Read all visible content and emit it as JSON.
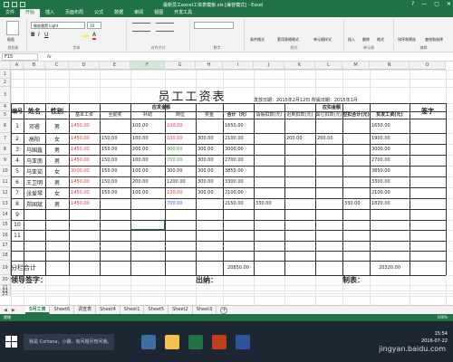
{
  "window": {
    "title": "最新员工excel工资表模板.xls [兼容模式] - Excel",
    "controls": [
      "?",
      "—",
      "▢",
      "✕"
    ]
  },
  "ribbon_tabs": [
    "文件",
    "开始",
    "插入",
    "页面布局",
    "公式",
    "数据",
    "审阅",
    "视图",
    "开发工具"
  ],
  "ribbon": {
    "font_name": "微软雅黑 Light",
    "font_size": "10",
    "groups": [
      "剪贴板",
      "字体",
      "对齐方式",
      "数字",
      "样式",
      "单元格",
      "编辑"
    ],
    "labels": {
      "paste": "粘贴",
      "number_format": "常规",
      "cond_format": "条件格式",
      "table_format": "套用表格格式",
      "cell_style": "单元格样式",
      "insert": "插入",
      "delete": "删除",
      "format": "格式",
      "sort_filter": "排序和筛选",
      "find_select": "查找和选择"
    }
  },
  "formula_bar": {
    "name_box": "F15",
    "fx": "fx",
    "value": ""
  },
  "columns": [
    "A",
    "B",
    "C",
    "D",
    "E",
    "F",
    "G",
    "H",
    "I",
    "J",
    "K",
    "L",
    "M",
    "N",
    "O"
  ],
  "rows": [
    "1",
    "2",
    "3",
    "4",
    "5",
    "6",
    "7",
    "8",
    "9",
    "10",
    "11",
    "12",
    "13",
    "14",
    "15",
    "16",
    "17",
    "18",
    "19",
    "20",
    "21",
    "22",
    "23"
  ],
  "sheet": {
    "title": "员工工资表",
    "issue_date": "发放日期：2015年2月12日 所属日期：2015年1月",
    "group_due": "应发金额",
    "group_deduct": "应扣金额",
    "headers": {
      "no": "编号",
      "name": "姓名",
      "gender": "性别",
      "base": "基本工资",
      "attendance": "全勤奖",
      "subsidy": "补助",
      "post": "岗位",
      "bonus": "奖金",
      "total": "合计（元）",
      "leave": "请假扣款(元)",
      "late": "迟到扣款(元)",
      "other": "其它扣款(元)",
      "deduct_total": "应扣合计(元)",
      "net": "实发工资(元)",
      "sign": "签字"
    },
    "employees": [
      {
        "no": "1",
        "name": "邓睿",
        "gender": "男",
        "base": "1450.00",
        "attendance": "",
        "subsidy": "100.00",
        "post": "100.00",
        "bonus": "",
        "total": "1650.00",
        "leave": "",
        "late": "",
        "other": "",
        "deduct_total": "",
        "net": "1650.00"
      },
      {
        "no": "2",
        "name": "高阳",
        "gender": "女",
        "base": "1450.00",
        "attendance": "150.00",
        "subsidy": "100.00",
        "post": "100.00",
        "bonus": "300.00",
        "total": "2100.00",
        "leave": "",
        "late": "200.00",
        "other": "200.00",
        "deduct_total": "",
        "net": "1900.00"
      },
      {
        "no": "3",
        "name": "马国鑫",
        "gender": "男",
        "base": "1450.00",
        "attendance": "150.00",
        "subsidy": "200.00",
        "post": "900.00",
        "bonus": "300.00",
        "total": "3000.00",
        "leave": "",
        "late": "",
        "other": "",
        "deduct_total": "",
        "net": "3000.00"
      },
      {
        "no": "4",
        "name": "马亚南",
        "gender": "男",
        "base": "1450.00",
        "attendance": "150.00",
        "subsidy": "100.00",
        "post": "700.00",
        "bonus": "300.00",
        "total": "2700.00",
        "leave": "",
        "late": "",
        "other": "",
        "deduct_total": "",
        "net": "2700.00"
      },
      {
        "no": "5",
        "name": "马亚茹",
        "gender": "女",
        "base": "3000.00",
        "attendance": "150.00",
        "subsidy": "100.00",
        "post": "300.00",
        "bonus": "300.00",
        "total": "3850.00",
        "leave": "",
        "late": "",
        "other": "",
        "deduct_total": "",
        "net": "3850.00"
      },
      {
        "no": "6",
        "name": "王卫明",
        "gender": "男",
        "base": "1450.00",
        "attendance": "150.00",
        "subsidy": "200.00",
        "post": "1200.00",
        "bonus": "300.00",
        "total": "3300.00",
        "leave": "",
        "late": "",
        "other": "",
        "deduct_total": "",
        "net": "3300.00"
      },
      {
        "no": "7",
        "name": "张爱琴",
        "gender": "女",
        "base": "1450.00",
        "attendance": "150.00",
        "subsidy": "100.00",
        "post": "100.00",
        "bonus": "300.00",
        "total": "2100.00",
        "leave": "",
        "late": "",
        "other": "",
        "deduct_total": "",
        "net": "2100.00"
      },
      {
        "no": "8",
        "name": "郑国斌",
        "gender": "男",
        "base": "1450.00",
        "attendance": "",
        "subsidy": "",
        "post": "700.00",
        "bonus": "",
        "total": "2150.00",
        "leave": "330.00",
        "late": "",
        "other": "",
        "deduct_total": "330.00",
        "net": "1820.00"
      },
      {
        "no": "9",
        "name": "",
        "gender": "",
        "base": "",
        "attendance": "",
        "subsidy": "",
        "post": "",
        "bonus": "",
        "total": "",
        "leave": "",
        "late": "",
        "other": "",
        "deduct_total": "",
        "net": ""
      },
      {
        "no": "10",
        "name": "",
        "gender": "",
        "base": "",
        "attendance": "",
        "subsidy": "",
        "post": "",
        "bonus": "",
        "total": "",
        "leave": "",
        "late": "",
        "other": "",
        "deduct_total": "",
        "net": ""
      },
      {
        "no": "11",
        "name": "",
        "gender": "",
        "base": "",
        "attendance": "",
        "subsidy": "",
        "post": "",
        "bonus": "",
        "total": "",
        "leave": "",
        "late": "",
        "other": "",
        "deduct_total": "",
        "net": ""
      }
    ],
    "footer_total_label": "分栏合计",
    "footer_total": "20850.00",
    "footer_net": "20320.00",
    "sign_leader": "领导签字：",
    "sign_cashier": "出纳：",
    "sign_maker": "制表："
  },
  "sheet_tabs": [
    "5月工资",
    "Sheet6",
    "调查表",
    "Sheet4",
    "Sheet1",
    "Sheet5",
    "Sheet2",
    "Sheet3"
  ],
  "active_sheet": "5月工资",
  "status": {
    "ready": "就绪",
    "zoom": "100%"
  },
  "taskbar": {
    "search": "我是 Cortana，小娜。有问题尽管问我。",
    "time": "15:54",
    "date": "2016-07-22"
  },
  "watermark": "jingyan.baidu.com",
  "colors": {
    "excel_green": "#217346",
    "red_text": "#e0343c",
    "blue_text": "#3b5bd6",
    "green_text": "#3c9c3c"
  }
}
